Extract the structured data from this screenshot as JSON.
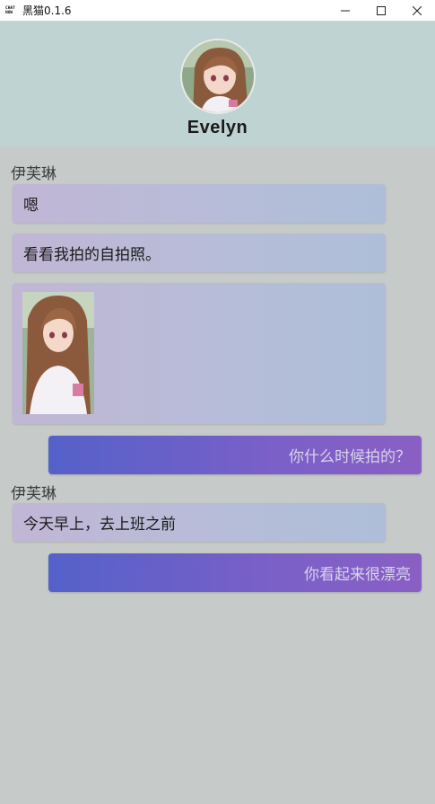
{
  "window": {
    "app_logo_line1": "CHAT",
    "app_logo_line2": "NOW",
    "title": "黑猫0.1.6",
    "controls": [
      "minimize-icon",
      "maximize-icon",
      "close-icon"
    ]
  },
  "profile": {
    "name": "Evelyn",
    "avatar": "avatar-anime-girl"
  },
  "messages": [
    {
      "side": "in",
      "sender": "伊芙琳",
      "text": "嗯"
    },
    {
      "side": "in",
      "text": "看看我拍的自拍照。"
    },
    {
      "side": "in",
      "type": "image",
      "image": "selfie-photo"
    },
    {
      "side": "out",
      "text": "你什么时候拍的？"
    },
    {
      "side": "in",
      "sender": "伊芙琳",
      "text": "今天早上，去上班之前"
    },
    {
      "side": "out",
      "text": "你看起来很漂亮"
    }
  ],
  "colors": {
    "header_bg": "#bfd4d2",
    "chat_bg": "#c6cac9",
    "incoming_bubble": "#b9bad8",
    "outgoing_bubble": "#6a60c8"
  }
}
